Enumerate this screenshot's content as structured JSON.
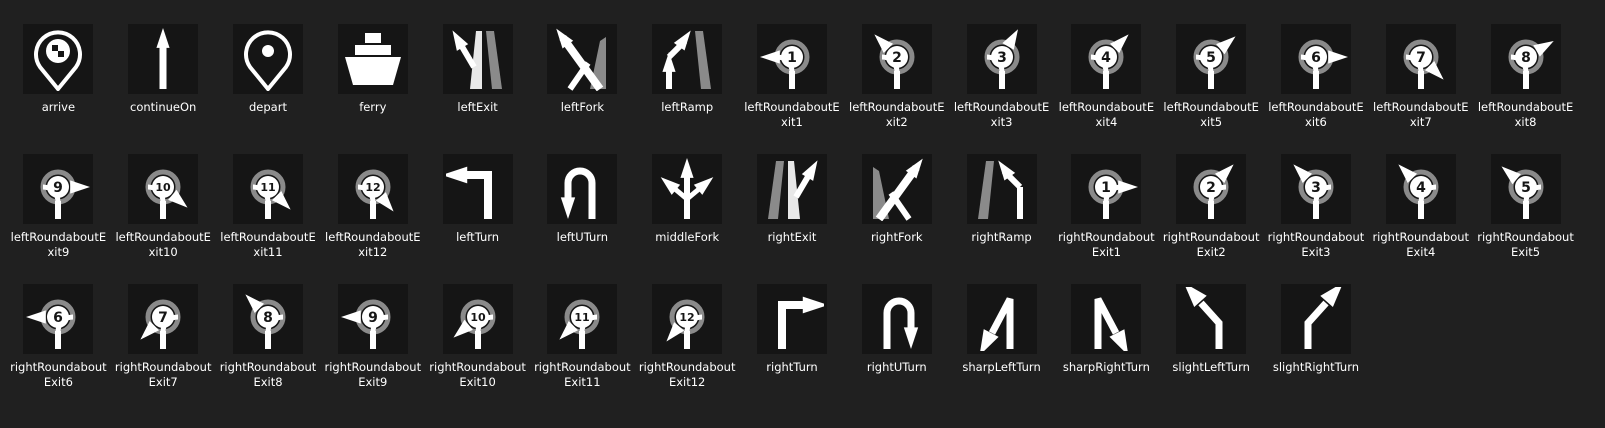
{
  "colors": {
    "background": "#202020",
    "icon": "#ffffff",
    "accent_gray": "#8a8a8a",
    "tile": "#151515"
  },
  "icons": [
    {
      "label": "arrive",
      "icon": "arrive-icon"
    },
    {
      "label": "continueOn",
      "icon": "continue-on-icon"
    },
    {
      "label": "depart",
      "icon": "depart-icon"
    },
    {
      "label": "ferry",
      "icon": "ferry-icon"
    },
    {
      "label": "leftExit",
      "icon": "left-exit-icon"
    },
    {
      "label": "leftFork",
      "icon": "left-fork-icon"
    },
    {
      "label": "leftRamp",
      "icon": "left-ramp-icon"
    },
    {
      "label": "leftRoundaboutExit1",
      "icon": "left-roundabout-exit1-icon",
      "number": "1"
    },
    {
      "label": "leftRoundaboutExit2",
      "icon": "left-roundabout-exit2-icon",
      "number": "2"
    },
    {
      "label": "leftRoundaboutExit3",
      "icon": "left-roundabout-exit3-icon",
      "number": "3"
    },
    {
      "label": "leftRoundaboutExit4",
      "icon": "left-roundabout-exit4-icon",
      "number": "4"
    },
    {
      "label": "leftRoundaboutExit5",
      "icon": "left-roundabout-exit5-icon",
      "number": "5"
    },
    {
      "label": "leftRoundaboutExit6",
      "icon": "left-roundabout-exit6-icon",
      "number": "6"
    },
    {
      "label": "leftRoundaboutExit7",
      "icon": "left-roundabout-exit7-icon",
      "number": "7"
    },
    {
      "label": "leftRoundaboutExit8",
      "icon": "left-roundabout-exit8-icon",
      "number": "8"
    },
    {
      "label": "leftRoundaboutExit9",
      "icon": "left-roundabout-exit9-icon",
      "number": "9"
    },
    {
      "label": "leftRoundaboutExit10",
      "icon": "left-roundabout-exit10-icon",
      "number": "10"
    },
    {
      "label": "leftRoundaboutExit11",
      "icon": "left-roundabout-exit11-icon",
      "number": "11"
    },
    {
      "label": "leftRoundaboutExit12",
      "icon": "left-roundabout-exit12-icon",
      "number": "12"
    },
    {
      "label": "leftTurn",
      "icon": "left-turn-icon"
    },
    {
      "label": "leftUTurn",
      "icon": "left-u-turn-icon"
    },
    {
      "label": "middleFork",
      "icon": "middle-fork-icon"
    },
    {
      "label": "rightExit",
      "icon": "right-exit-icon"
    },
    {
      "label": "rightFork",
      "icon": "right-fork-icon"
    },
    {
      "label": "rightRamp",
      "icon": "right-ramp-icon"
    },
    {
      "label": "rightRoundaboutExit1",
      "icon": "right-roundabout-exit1-icon",
      "number": "1"
    },
    {
      "label": "rightRoundaboutExit2",
      "icon": "right-roundabout-exit2-icon",
      "number": "2"
    },
    {
      "label": "rightRoundaboutExit3",
      "icon": "right-roundabout-exit3-icon",
      "number": "3"
    },
    {
      "label": "rightRoundaboutExit4",
      "icon": "right-roundabout-exit4-icon",
      "number": "4"
    },
    {
      "label": "rightRoundaboutExit5",
      "icon": "right-roundabout-exit5-icon",
      "number": "5"
    },
    {
      "label": "rightRoundaboutExit6",
      "icon": "right-roundabout-exit6-icon",
      "number": "6"
    },
    {
      "label": "rightRoundaboutExit7",
      "icon": "right-roundabout-exit7-icon",
      "number": "7"
    },
    {
      "label": "rightRoundaboutExit8",
      "icon": "right-roundabout-exit8-icon",
      "number": "8"
    },
    {
      "label": "rightRoundaboutExit9",
      "icon": "right-roundabout-exit9-icon",
      "number": "9"
    },
    {
      "label": "rightRoundaboutExit10",
      "icon": "right-roundabout-exit10-icon",
      "number": "10"
    },
    {
      "label": "rightRoundaboutExit11",
      "icon": "right-roundabout-exit11-icon",
      "number": "11"
    },
    {
      "label": "rightRoundaboutExit12",
      "icon": "right-roundabout-exit12-icon",
      "number": "12"
    },
    {
      "label": "rightTurn",
      "icon": "right-turn-icon"
    },
    {
      "label": "rightUTurn",
      "icon": "right-u-turn-icon"
    },
    {
      "label": "sharpLeftTurn",
      "icon": "sharp-left-turn-icon"
    },
    {
      "label": "sharpRightTurn",
      "icon": "sharp-right-turn-icon"
    },
    {
      "label": "slightLeftTurn",
      "icon": "slight-left-turn-icon"
    },
    {
      "label": "slightRightTurn",
      "icon": "slight-right-turn-icon"
    }
  ]
}
